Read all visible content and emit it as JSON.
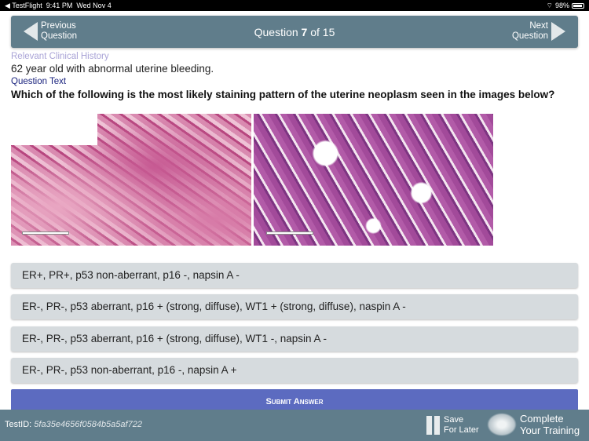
{
  "status_bar": {
    "back_app": "◀ TestFlight",
    "time": "9:41 PM",
    "date": "Wed Nov 4",
    "battery": "98%"
  },
  "nav": {
    "prev_line1": "Previous",
    "prev_line2": "Question",
    "title_prefix": "Question ",
    "current": "7",
    "title_suffix": " of 15",
    "next_line1": "Next",
    "next_line2": "Question"
  },
  "clinical_history": {
    "label": "Relevant Clinical History",
    "text": "62 year old with abnormal uterine bleeding."
  },
  "question": {
    "label": "Question Text",
    "text": "Which of the following is the most likely staining pattern of the uterine neoplasm seen in the images below?"
  },
  "options": [
    "ER+, PR+, p53 non-aberrant, p16 -, napsin A -",
    "ER-, PR-, p53 aberrant, p16 + (strong, diffuse), WT1 + (strong, diffuse), naspin A -",
    "ER-, PR-, p53 aberrant, p16 + (strong, diffuse), WT1 -, napsin A -",
    "ER-, PR-, p53 non-aberrant, p16 -, napsin A +"
  ],
  "submit_label": "Submit Answer",
  "footer": {
    "test_id_label": "TestID: ",
    "test_id": "5fa35e4656f0584b5a5af722",
    "save_line1": "Save",
    "save_line2": "For Later",
    "complete_line1": "Complete",
    "complete_line2": "Your Training"
  }
}
